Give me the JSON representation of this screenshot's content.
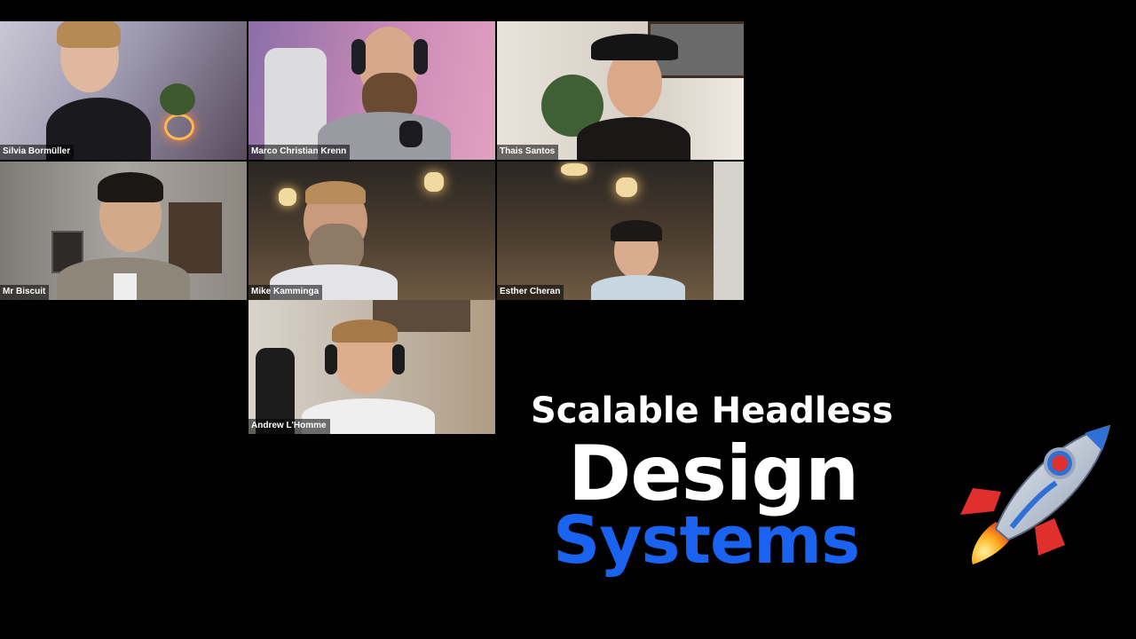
{
  "participants": [
    {
      "name": "Silvia Bormüller"
    },
    {
      "name": "Marco Christian Krenn"
    },
    {
      "name": "Thais Santos"
    },
    {
      "name": "Mr Biscuit"
    },
    {
      "name": "Mike Kamminga"
    },
    {
      "name": "Esther Cheran"
    },
    {
      "name": "Andrew L'Homme"
    }
  ],
  "title": {
    "line1": "Scalable Headless",
    "line2": "Design",
    "line3": "Systems"
  },
  "colors": {
    "background": "#000000",
    "accent_blue": "#1a63f0",
    "text_white": "#ffffff"
  },
  "icons": {
    "rocket": "rocket-icon"
  }
}
